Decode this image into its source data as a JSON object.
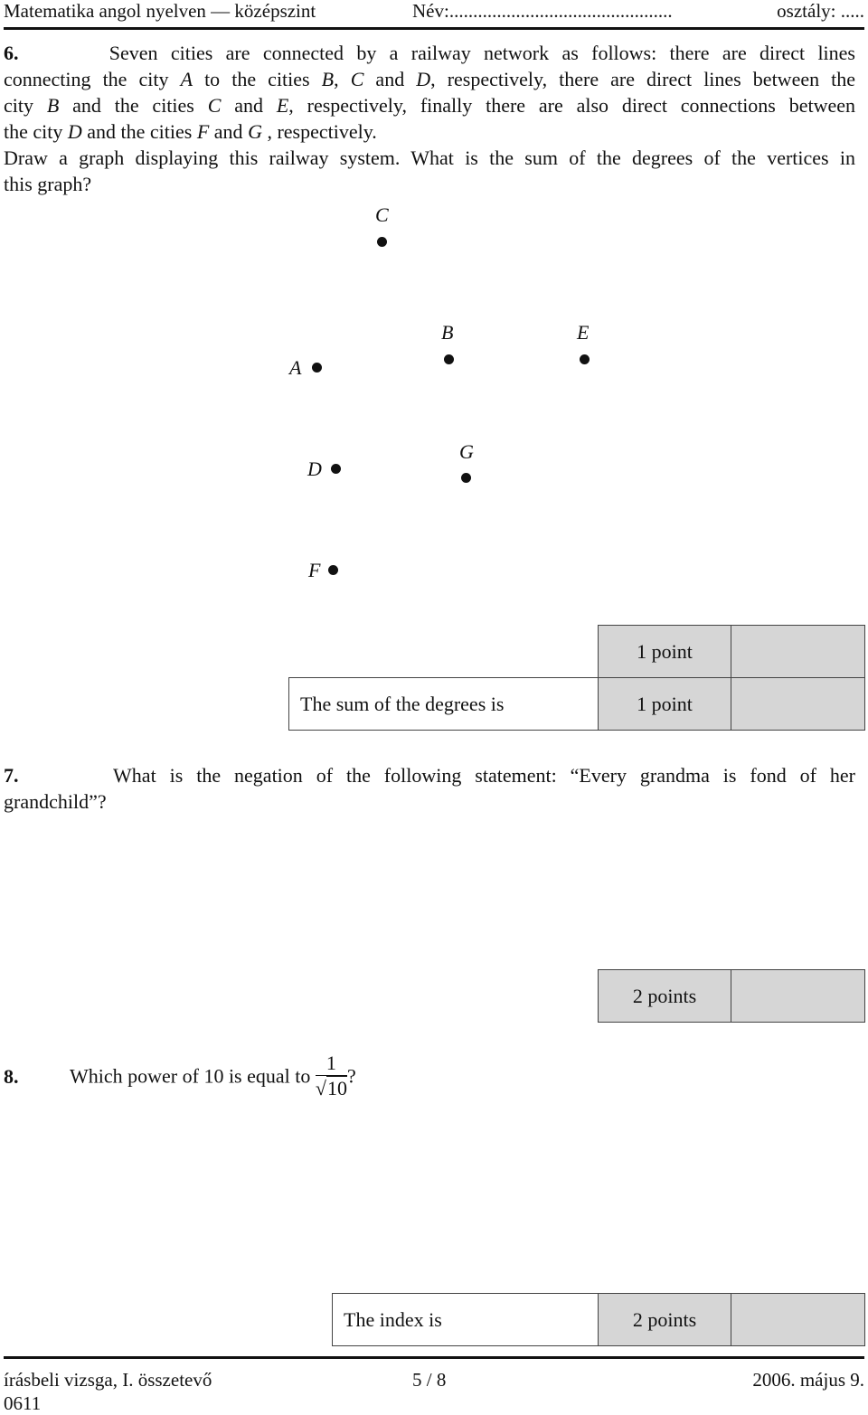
{
  "header": {
    "subject": "Matematika angol nyelven — középszint",
    "name_field": "Név:...............................................",
    "class_field": "osztály: ....."
  },
  "q6": {
    "number": "6.",
    "lines": [
      [
        "Seven cities are connected by a railway network as follows: there are direct lines"
      ],
      [
        "connecting the city ",
        {
          "i": "A"
        },
        " to the cities ",
        {
          "i": "B"
        },
        ", ",
        {
          "i": "C"
        },
        " and ",
        {
          "i": "D"
        },
        ", respectively, there are direct lines between the"
      ],
      [
        "city ",
        {
          "i": "B"
        },
        " and the cities ",
        {
          "i": "C"
        },
        " and ",
        {
          "i": "E"
        },
        ", respectively, finally there are also direct connections between"
      ],
      [
        "the city ",
        {
          "i": "D"
        },
        " and the cities ",
        {
          "i": "F"
        },
        " and ",
        {
          "i": "G"
        },
        " , respectively."
      ],
      [
        "Draw a graph displaying this railway system. What is the sum of the degrees of the vertices in"
      ],
      [
        "this graph?"
      ]
    ],
    "vertices": [
      {
        "id": "C",
        "label": "C"
      },
      {
        "id": "B",
        "label": "B"
      },
      {
        "id": "E",
        "label": "E"
      },
      {
        "id": "A",
        "label": "A"
      },
      {
        "id": "D",
        "label": "D"
      },
      {
        "id": "G",
        "label": "G"
      },
      {
        "id": "F",
        "label": "F"
      }
    ],
    "score_table": {
      "row1_points": "1 point",
      "answer_label": "The sum of the degrees is",
      "row2_points": "1 point"
    }
  },
  "q7": {
    "number": "7.",
    "line1": "What is the negation of the following statement: “Every grandma is fond of her",
    "line2": "grandchild”?",
    "score_table": {
      "points": "2 points"
    }
  },
  "q8": {
    "number": "8.",
    "text": "Which power of 10 is equal to",
    "frac_num": "1",
    "frac_den_radical": "√",
    "frac_den_value": "10",
    "end": "?",
    "score_table": {
      "answer_label": "The index is",
      "points": "2 points"
    }
  },
  "footer": {
    "left_line1": "írásbeli vizsga, I. összetevő",
    "left_line2": "0611",
    "page": "5 / 8",
    "date": "2006. május 9."
  }
}
